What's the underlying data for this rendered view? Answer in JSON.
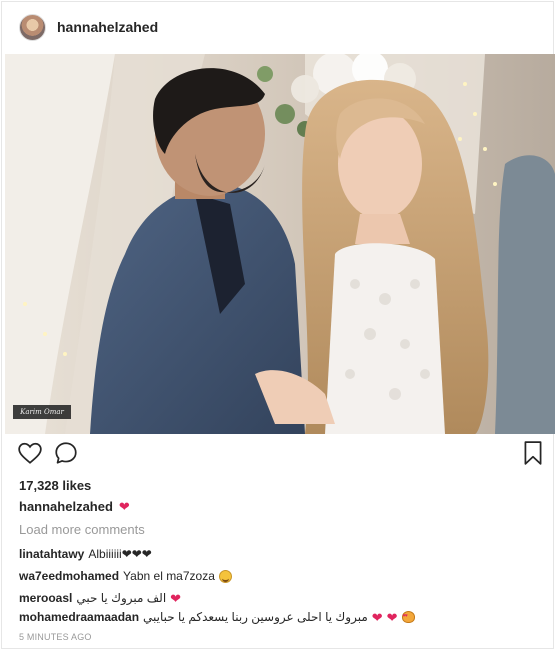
{
  "post": {
    "username": "hannahelzahed",
    "photo_watermark": "Karim Omar",
    "likes": "17,328 likes",
    "caption": {
      "user": "hannahelzahed",
      "emoji": "❤"
    },
    "load_more": "Load more comments",
    "comments": [
      {
        "user": "linatahtawy",
        "text": "Albiiiiii❤❤❤",
        "emoji": ""
      },
      {
        "user": "wa7eedmohamed",
        "text": "Yabn el ma7zoza",
        "emoji": "grinning-face"
      },
      {
        "user": "merooasl",
        "text": "الف مبروك يا حبي",
        "emoji": "❤"
      },
      {
        "user": "mohamedraamaadan",
        "text": "مبروك يا احلى عروسين ربنا يسعدكم يا حبايبي",
        "emoji": "❤ ❤ cat-heart-eyes"
      }
    ],
    "timestamp": "5 MINUTES AGO"
  },
  "icons": {
    "like": "heart-outline-icon",
    "comment": "comment-bubble-icon",
    "save": "bookmark-icon"
  },
  "colors": {
    "text": "#262626",
    "muted": "#999999",
    "heart": "#e0245e"
  }
}
